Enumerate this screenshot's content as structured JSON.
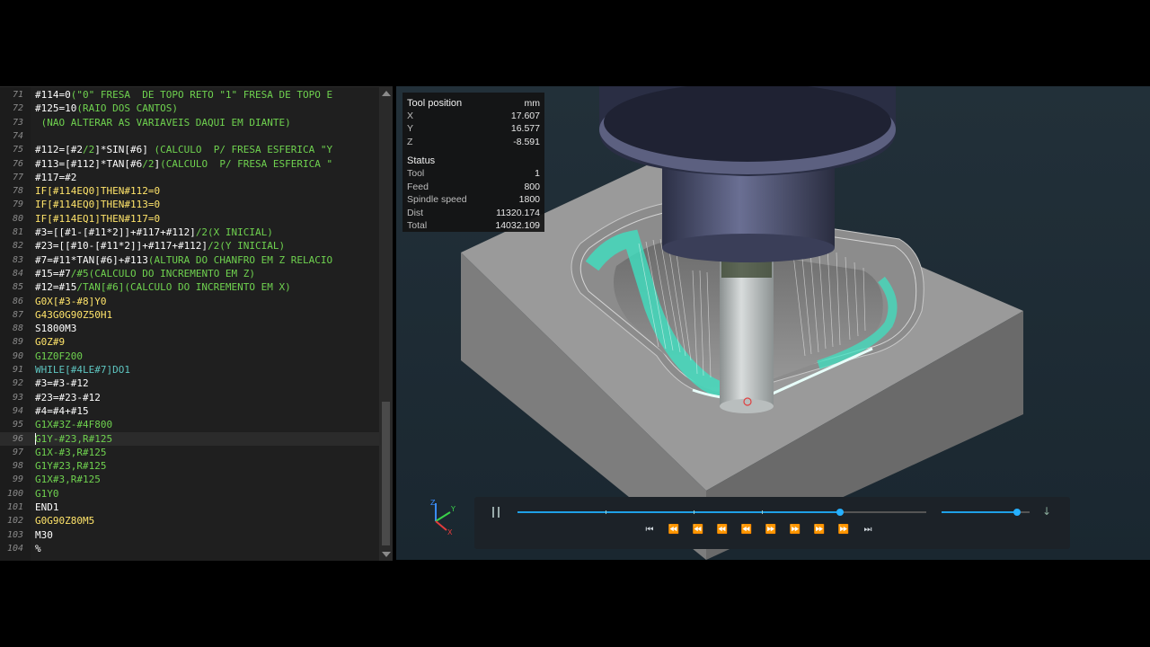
{
  "editor": {
    "lines": [
      {
        "n": "71",
        "code": [
          [
            "w",
            "#114=0"
          ],
          [
            "g",
            "(\"0\" FRESA  DE TOPO RETO \"1\" FRESA DE TOPO E"
          ]
        ]
      },
      {
        "n": "72",
        "code": [
          [
            "w",
            "#125=10"
          ],
          [
            "g",
            "(RAIO DOS CANTOS)"
          ]
        ]
      },
      {
        "n": "73",
        "code": [
          [
            "g",
            " (NAO ALTERAR AS VARIAVEIS DAQUI EM DIANTE)"
          ]
        ]
      },
      {
        "n": "74",
        "code": []
      },
      {
        "n": "75",
        "code": [
          [
            "w",
            "#112=[#2"
          ],
          [
            "g",
            "/2"
          ],
          [
            "w",
            "]*SIN[#6] "
          ],
          [
            "g",
            "(CALCULO  P/ FRESA ESFERICA \"Y"
          ]
        ]
      },
      {
        "n": "76",
        "code": [
          [
            "w",
            "#113=[#112]*TAN[#6"
          ],
          [
            "g",
            "/2"
          ],
          [
            "w",
            "]"
          ],
          [
            "g",
            "(CALCULO  P/ FRESA ESFERICA \""
          ]
        ]
      },
      {
        "n": "77",
        "code": [
          [
            "w",
            "#117=#2"
          ]
        ]
      },
      {
        "n": "78",
        "code": [
          [
            "y",
            "IF[#114EQ0]THEN#112=0"
          ]
        ]
      },
      {
        "n": "79",
        "code": [
          [
            "y",
            "IF[#114EQ0]THEN#113=0"
          ]
        ]
      },
      {
        "n": "80",
        "code": [
          [
            "y",
            "IF[#114EQ1]THEN#117=0"
          ]
        ]
      },
      {
        "n": "81",
        "code": [
          [
            "w",
            "#3=[[#1-[#11*2]]+#117+#112]"
          ],
          [
            "g",
            "/2(X INICIAL)"
          ]
        ]
      },
      {
        "n": "82",
        "code": [
          [
            "w",
            "#23=[[#10-[#11*2]]+#117+#112]"
          ],
          [
            "g",
            "/2(Y INICIAL)"
          ]
        ]
      },
      {
        "n": "83",
        "code": [
          [
            "w",
            "#7=#11*TAN[#6]+#113"
          ],
          [
            "g",
            "(ALTURA DO CHANFRO EM Z RELACIO"
          ]
        ]
      },
      {
        "n": "84",
        "code": [
          [
            "w",
            "#15=#7"
          ],
          [
            "g",
            "/#5(CALCULO DO INCREMENTO EM Z)"
          ]
        ]
      },
      {
        "n": "85",
        "code": [
          [
            "w",
            "#12=#15"
          ],
          [
            "g",
            "/TAN[#6](CALCULO DO INCREMENTO EM X)"
          ]
        ]
      },
      {
        "n": "86",
        "code": [
          [
            "y",
            "G0X[#3-#8]Y0"
          ]
        ]
      },
      {
        "n": "87",
        "code": [
          [
            "y",
            "G43G0G90Z50H1"
          ]
        ]
      },
      {
        "n": "88",
        "code": [
          [
            "w",
            "S1800M3"
          ]
        ]
      },
      {
        "n": "89",
        "code": [
          [
            "y",
            "G0Z#9"
          ]
        ]
      },
      {
        "n": "90",
        "code": [
          [
            "g",
            "G1Z0F200"
          ]
        ]
      },
      {
        "n": "91",
        "code": [
          [
            "c",
            "WHILE[#4LE#7]DO1"
          ]
        ]
      },
      {
        "n": "92",
        "code": [
          [
            "w",
            "#3=#3-#12"
          ]
        ]
      },
      {
        "n": "93",
        "code": [
          [
            "w",
            "#23=#23-#12"
          ]
        ]
      },
      {
        "n": "94",
        "code": [
          [
            "w",
            "#4=#4+#15"
          ]
        ]
      },
      {
        "n": "95",
        "code": [
          [
            "g",
            "G1X#3Z-#4F800"
          ]
        ]
      },
      {
        "n": "96",
        "code": [
          [
            "g",
            "G1Y-#23,R#125"
          ]
        ],
        "current": true
      },
      {
        "n": "97",
        "code": [
          [
            "g",
            "G1X-#3,R#125"
          ]
        ]
      },
      {
        "n": "98",
        "code": [
          [
            "g",
            "G1Y#23,R#125"
          ]
        ]
      },
      {
        "n": "99",
        "code": [
          [
            "g",
            "G1X#3,R#125"
          ]
        ]
      },
      {
        "n": "100",
        "code": [
          [
            "g",
            "G1Y0"
          ]
        ]
      },
      {
        "n": "101",
        "code": [
          [
            "w",
            "END1"
          ]
        ]
      },
      {
        "n": "102",
        "code": [
          [
            "y",
            "G0G90Z80M5"
          ]
        ]
      },
      {
        "n": "103",
        "code": [
          [
            "w",
            "M30"
          ]
        ]
      },
      {
        "n": "104",
        "code": [
          [
            "w",
            "%"
          ]
        ]
      }
    ]
  },
  "info": {
    "tool_position_label": "Tool position",
    "unit": "mm",
    "x_label": "X",
    "x_value": "17.607",
    "y_label": "Y",
    "y_value": "16.577",
    "z_label": "Z",
    "z_value": "-8.591",
    "status_label": "Status",
    "tool_label": "Tool",
    "tool_value": "1",
    "feed_label": "Feed",
    "feed_value": "800",
    "spindle_label": "Spindle speed",
    "spindle_value": "1800",
    "dist_label": "Dist",
    "dist_value": "11320.174",
    "total_label": "Total",
    "total_value": "14032.109"
  },
  "player": {
    "progress": 0.79,
    "speed": 0.86,
    "buttons": [
      "⏮",
      "⏪",
      "⏪",
      "⏪",
      "⏪",
      "⏩",
      "⏩",
      "⏩",
      "⏩",
      "⏭"
    ]
  },
  "axes": {
    "x": "X",
    "y": "Y",
    "z": "Z"
  },
  "colors": {
    "accent": "#1fa0e6",
    "toolpath": "#3fe0c0",
    "block": "#8e8e8e",
    "background": "#1e2a33"
  }
}
